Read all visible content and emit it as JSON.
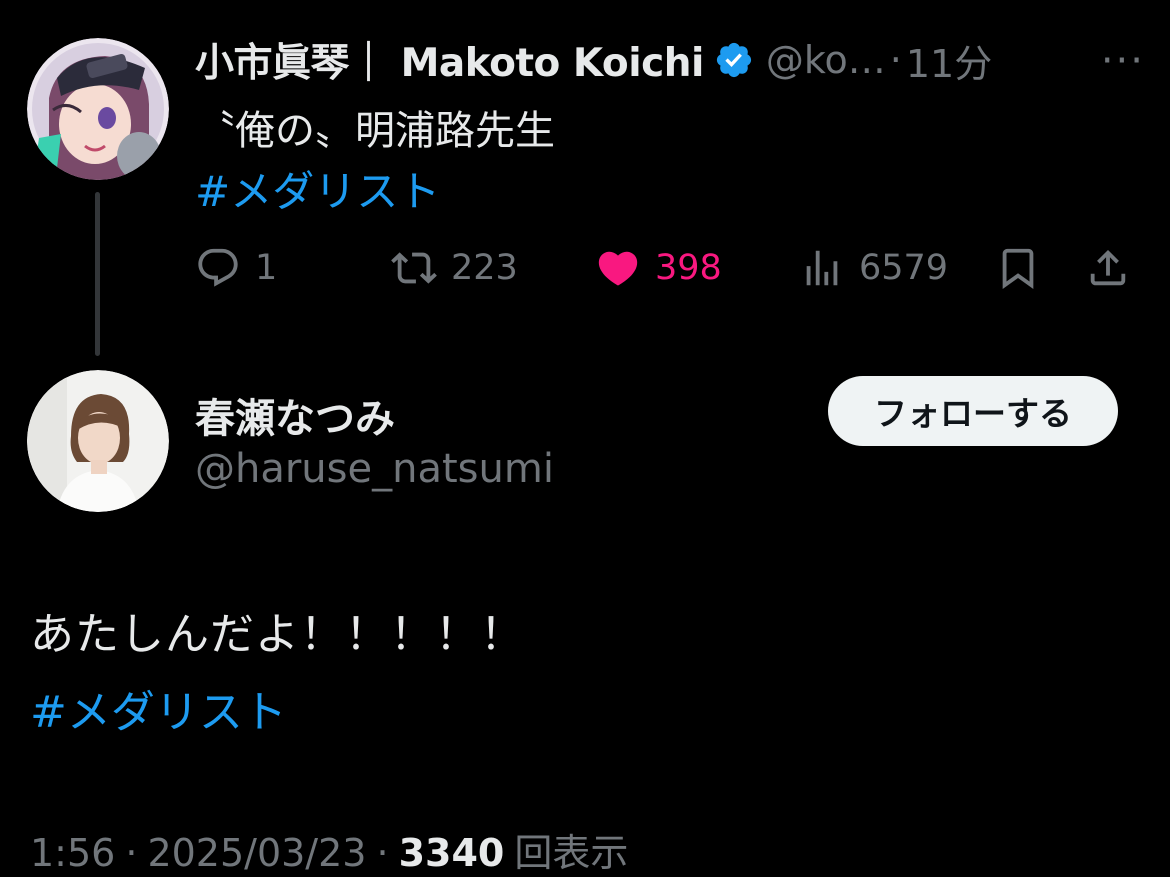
{
  "parent_tweet": {
    "display_name": "小市眞琴｜ Makoto Koichi",
    "handle": "@ko…",
    "separator": "·",
    "time_ago": "11分",
    "more_label": "···",
    "text": "〝俺の〟明浦路先生",
    "hashtag": "#メダリスト",
    "icons": {
      "reply": "reply-icon",
      "retweet": "retweet-icon",
      "like": "heart-icon",
      "views": "views-chart-icon",
      "bookmark": "bookmark-icon",
      "share": "share-icon",
      "verified": "verified-badge-icon"
    },
    "stats": {
      "replies": "1",
      "retweets": "223",
      "likes": "398",
      "views": "6579"
    }
  },
  "reply_tweet": {
    "display_name": "春瀬なつみ",
    "handle": "@haruse_natsumi",
    "follow_label": "フォローする",
    "text": "あたしんだよ！！！！！",
    "hashtag": "#メダリスト",
    "meta": {
      "time": "1:56",
      "separator": "·",
      "date": "2025/03/23",
      "views_count": "3340",
      "views_label": "回表示"
    }
  },
  "colors": {
    "background": "#000000",
    "text_primary": "#e7e9ea",
    "text_secondary": "#71767b",
    "link": "#1d9bf0",
    "like": "#f91880",
    "verified": "#1d9bf0",
    "follow_button_bg": "#eff3f4"
  }
}
